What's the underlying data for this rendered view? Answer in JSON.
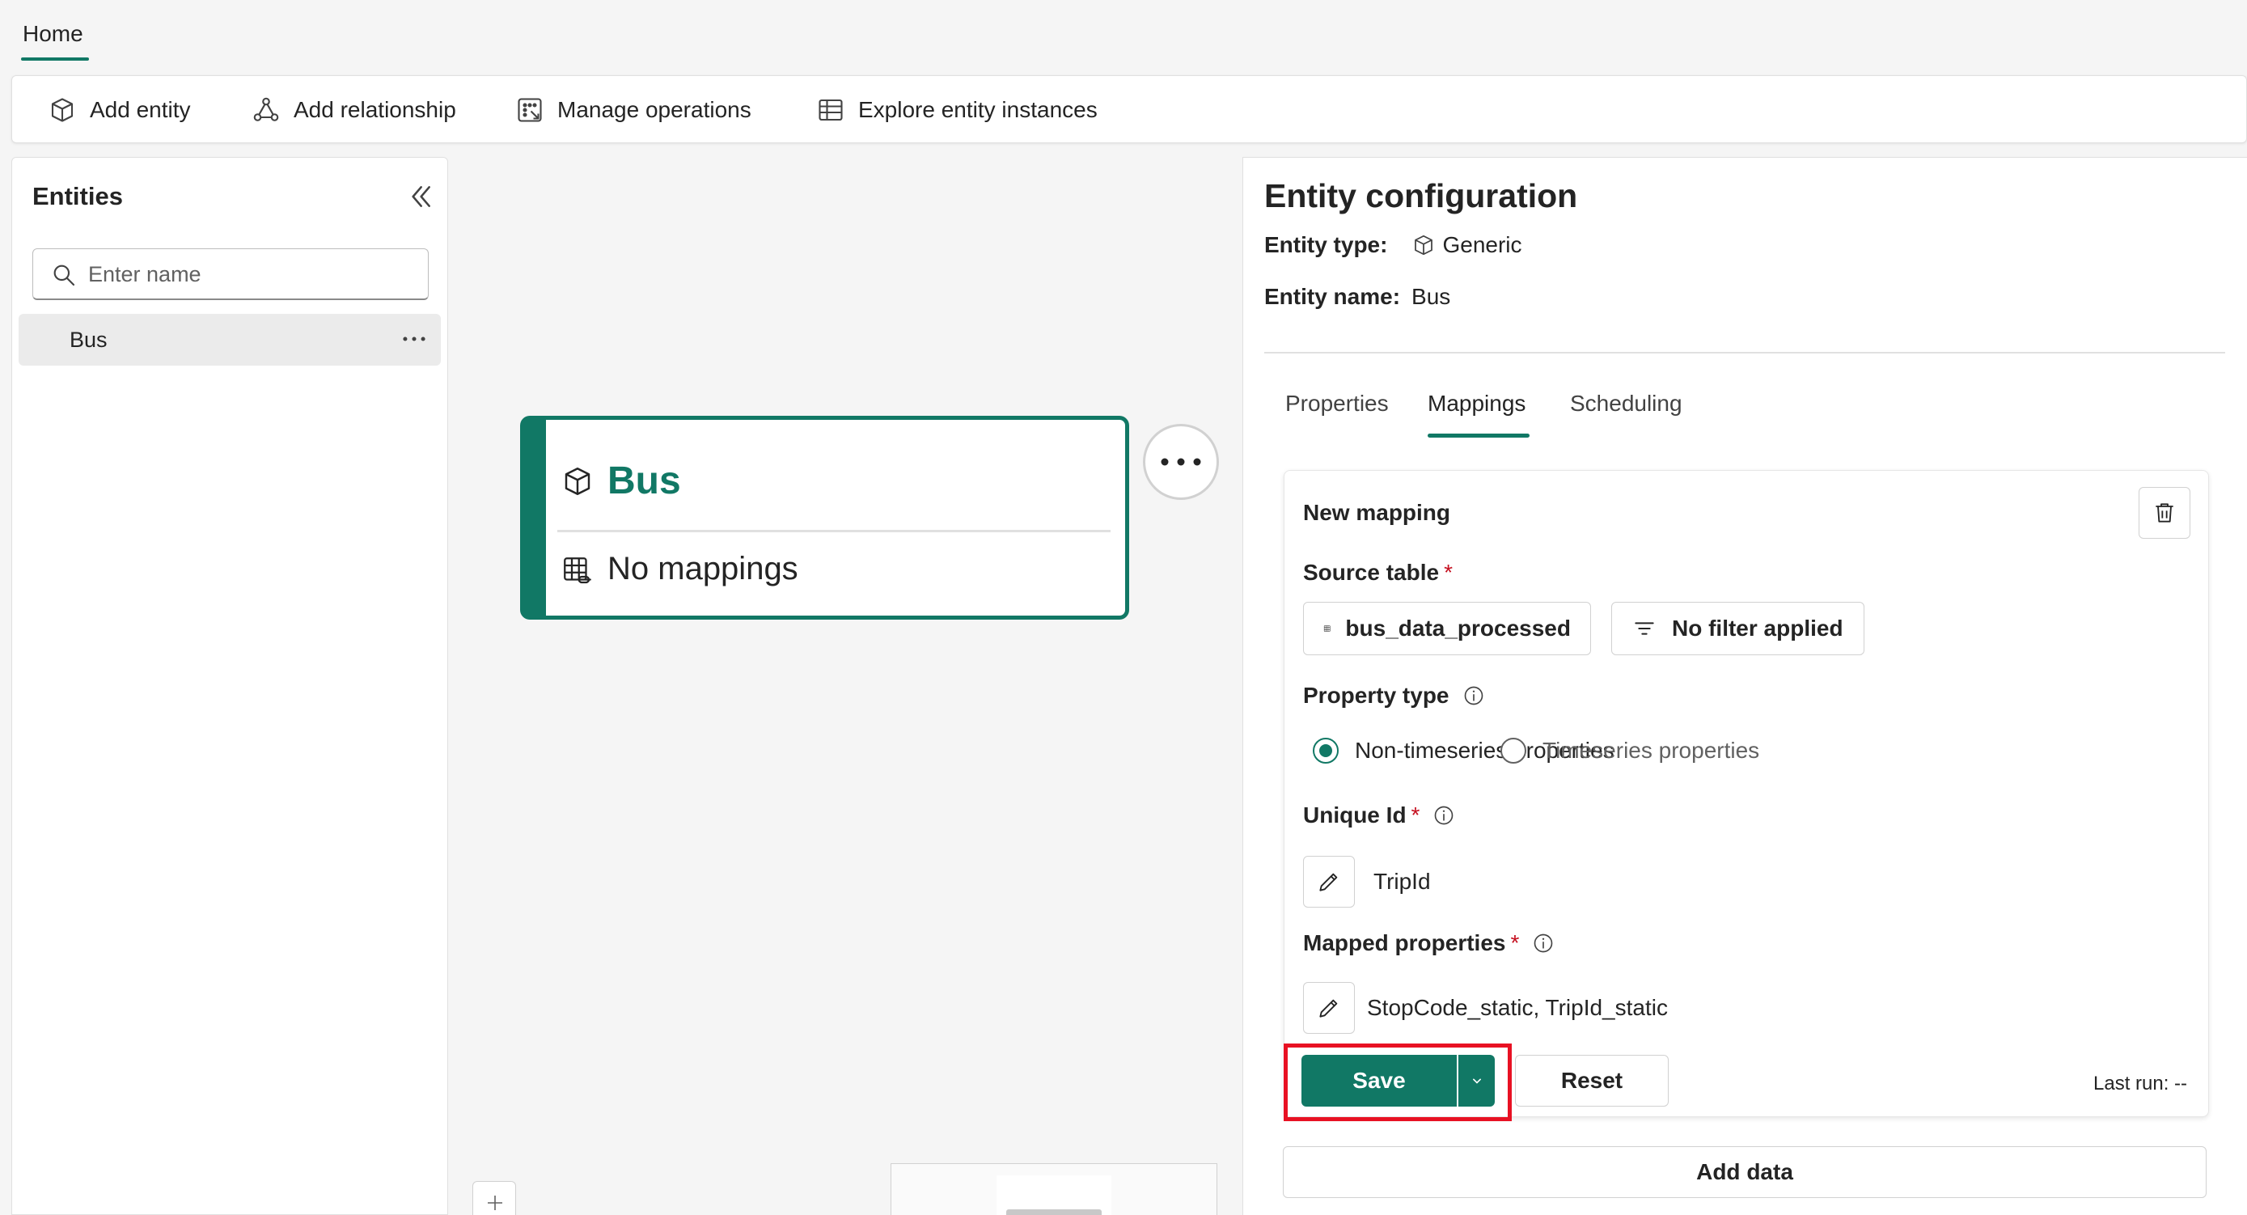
{
  "top_tabs": {
    "home": "Home"
  },
  "ribbon": {
    "add_entity": "Add entity",
    "add_relationship": "Add relationship",
    "manage_operations": "Manage operations",
    "explore_entity_instances": "Explore entity instances"
  },
  "entities_panel": {
    "title": "Entities",
    "search_placeholder": "Enter name",
    "items": [
      {
        "label": "Bus",
        "more": "···"
      }
    ]
  },
  "canvas": {
    "node": {
      "title": "Bus",
      "mappings": "No mappings"
    },
    "zoom_in": "+"
  },
  "config": {
    "title": "Entity configuration",
    "entity_type_label": "Entity type:",
    "entity_type_value": "Generic",
    "entity_name_label": "Entity name:",
    "entity_name_value": "Bus",
    "tabs": [
      "Properties",
      "Mappings",
      "Scheduling"
    ],
    "active_tab": "Mappings",
    "mapping": {
      "title": "New mapping",
      "source_table_label": "Source table",
      "required_mark": "*",
      "source_table_value": "bus_data_processed",
      "filter_value": "No filter applied",
      "property_type_label": "Property type",
      "radio_non_timeseries": "Non-timeseries properties",
      "radio_timeseries": "Timeseries properties",
      "selected_property_type": "Non-timeseries properties",
      "unique_id_label": "Unique Id",
      "unique_id_value": "TripId",
      "mapped_properties_label": "Mapped properties",
      "mapped_properties_value": "StopCode_static, TripId_static",
      "save_label": "Save",
      "reset_label": "Reset",
      "last_run": "Last run: --"
    },
    "add_data_label": "Add data"
  },
  "colors": {
    "accent": "#117865",
    "highlight": "#e81123",
    "required": "#c50f1f"
  }
}
